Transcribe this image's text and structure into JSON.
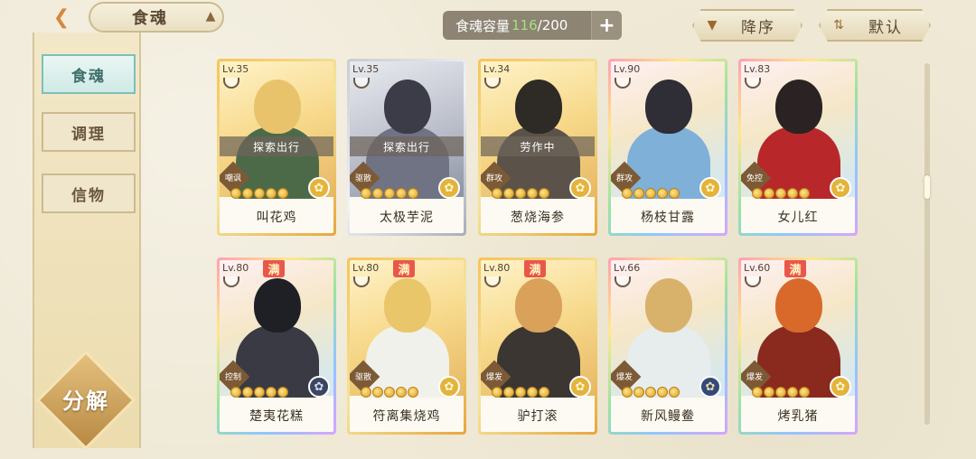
{
  "header": {
    "back_icon": "chevron-left-icon",
    "title": "食魂",
    "capacity_label": "食魂容量",
    "capacity_current": "116",
    "capacity_total": "/200",
    "add_label": "+",
    "sort_desc_label": "降序",
    "sort_default_label": "默认"
  },
  "sidebar": {
    "items": [
      {
        "label": "食魂",
        "active": true
      },
      {
        "label": "调理",
        "active": false
      },
      {
        "label": "信物",
        "active": false
      }
    ],
    "decompose_label": "分解"
  },
  "cards": [
    {
      "level": "Lv.35",
      "name": "叫花鸡",
      "status": "探索出行",
      "tag": "嘲讽",
      "stars": 5,
      "full": false,
      "frame": "gold",
      "element": "gold",
      "colors": [
        "#e9c36c",
        "#4d6a48"
      ]
    },
    {
      "level": "Lv.35",
      "name": "太极芋泥",
      "status": "探索出行",
      "tag": "驱散",
      "stars": 5,
      "full": false,
      "frame": "silver",
      "element": "gold",
      "colors": [
        "#3c3c48",
        "#707384"
      ]
    },
    {
      "level": "Lv.34",
      "name": "葱烧海参",
      "status": "劳作中",
      "tag": "群攻",
      "stars": 5,
      "full": false,
      "frame": "gold",
      "element": "gold",
      "colors": [
        "#2e2a26",
        "#5b524a"
      ]
    },
    {
      "level": "Lv.90",
      "name": "杨枝甘露",
      "status": "",
      "tag": "群攻",
      "stars": 5,
      "full": false,
      "frame": "rainbow",
      "element": "gold",
      "colors": [
        "#2f2d36",
        "#7fb0d8"
      ]
    },
    {
      "level": "Lv.83",
      "name": "女儿红",
      "status": "",
      "tag": "免控",
      "stars": 5,
      "full": false,
      "frame": "rainbow",
      "element": "gold",
      "colors": [
        "#2b2224",
        "#b8282a"
      ]
    },
    {
      "level": "Lv.80",
      "name": "楚夷花糕",
      "status": "",
      "tag": "控制",
      "stars": 5,
      "full": true,
      "frame": "rainbow",
      "element": "dark",
      "colors": [
        "#1f2026",
        "#3a3a44"
      ]
    },
    {
      "level": "Lv.80",
      "name": "符离集烧鸡",
      "status": "",
      "tag": "驱散",
      "stars": 5,
      "full": true,
      "frame": "gold",
      "element": "gold",
      "colors": [
        "#e9c66a",
        "#f1f1ec"
      ]
    },
    {
      "level": "Lv.80",
      "name": "驴打滚",
      "status": "",
      "tag": "爆发",
      "stars": 5,
      "full": true,
      "frame": "gold",
      "element": "gold",
      "colors": [
        "#d9a15a",
        "#3c3633"
      ]
    },
    {
      "level": "Lv.66",
      "name": "新风鳗鲞",
      "status": "",
      "tag": "爆发",
      "stars": 5,
      "full": false,
      "frame": "rainbow",
      "element": "blue",
      "colors": [
        "#d8b26a",
        "#e7ecec"
      ]
    },
    {
      "level": "Lv.60",
      "name": "烤乳猪",
      "status": "",
      "tag": "爆发",
      "stars": 5,
      "full": true,
      "frame": "rainbow",
      "element": "gold",
      "colors": [
        "#d9692b",
        "#8a2a1e"
      ]
    }
  ],
  "full_badge_label": "满",
  "colors": {
    "background": "#efe9d6",
    "accent_green": "#a6e07b",
    "active_tab": "#cfeae6"
  }
}
